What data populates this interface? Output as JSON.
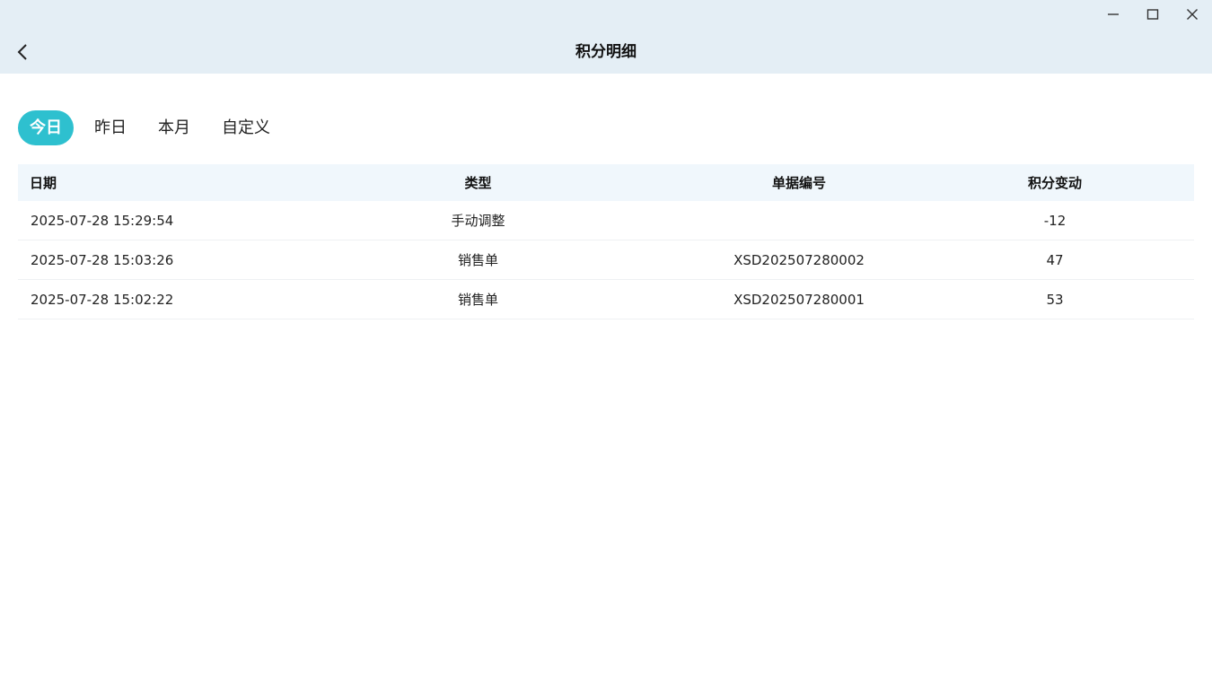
{
  "window": {
    "controls": [
      "minimize-icon",
      "maximize-icon",
      "close-icon"
    ]
  },
  "header": {
    "back_icon": "chevron-left-icon",
    "title": "积分明细"
  },
  "tabs": [
    {
      "label": "今日",
      "active": true
    },
    {
      "label": "昨日",
      "active": false
    },
    {
      "label": "本月",
      "active": false
    },
    {
      "label": "自定义",
      "active": false
    }
  ],
  "table": {
    "columns": [
      "日期",
      "类型",
      "单据编号",
      "积分变动"
    ],
    "rows": [
      {
        "date": "2025-07-28 15:29:54",
        "type": "手动调整",
        "doc_no": "",
        "change": "-12"
      },
      {
        "date": "2025-07-28 15:03:26",
        "type": "销售单",
        "doc_no": "XSD202507280002",
        "change": "47"
      },
      {
        "date": "2025-07-28 15:02:22",
        "type": "销售单",
        "doc_no": "XSD202507280001",
        "change": "53"
      }
    ]
  },
  "colors": {
    "accent": "#2ec0cf",
    "titlebar_bg": "#e4eef5",
    "table_header_bg": "#f0f7fc"
  }
}
